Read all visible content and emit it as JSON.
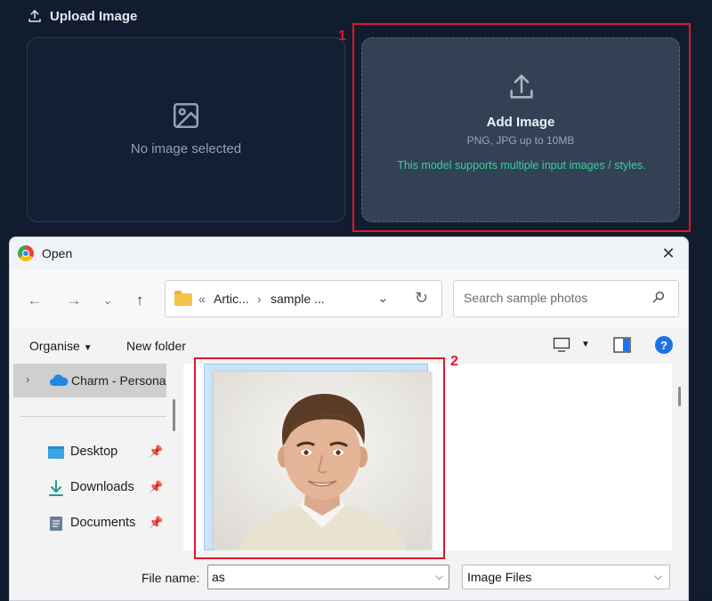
{
  "upload": {
    "header": "Upload Image",
    "empty_text": "No image selected",
    "add_title": "Add Image",
    "add_sub": "PNG, JPG up to 10MB",
    "add_note": "This model supports multiple input images / styles."
  },
  "annotations": {
    "label_1": "1",
    "label_2": "2",
    "color": "#e0162b"
  },
  "dialog": {
    "title": "Open",
    "close": "✕",
    "breadcrumb": {
      "sep_left": "«",
      "part1": "Artic...",
      "sep": "›",
      "part2": "sample ..."
    },
    "search_placeholder": "Search sample photos",
    "toolbar": {
      "organise": "Organise",
      "new_folder": "New folder",
      "help": "?"
    },
    "sidebar": {
      "cloud_label": "Charm - Persona",
      "items": [
        {
          "label": "Desktop",
          "icon": "desktop-icon"
        },
        {
          "label": "Downloads",
          "icon": "download-icon"
        },
        {
          "label": "Documents",
          "icon": "document-icon"
        }
      ]
    },
    "file_name_label": "File name:",
    "file_name_value": "as",
    "file_type": "Image Files"
  },
  "colors": {
    "accent_green": "#34d399",
    "panel_bg": "#334155",
    "app_bg": "#111c2e"
  }
}
